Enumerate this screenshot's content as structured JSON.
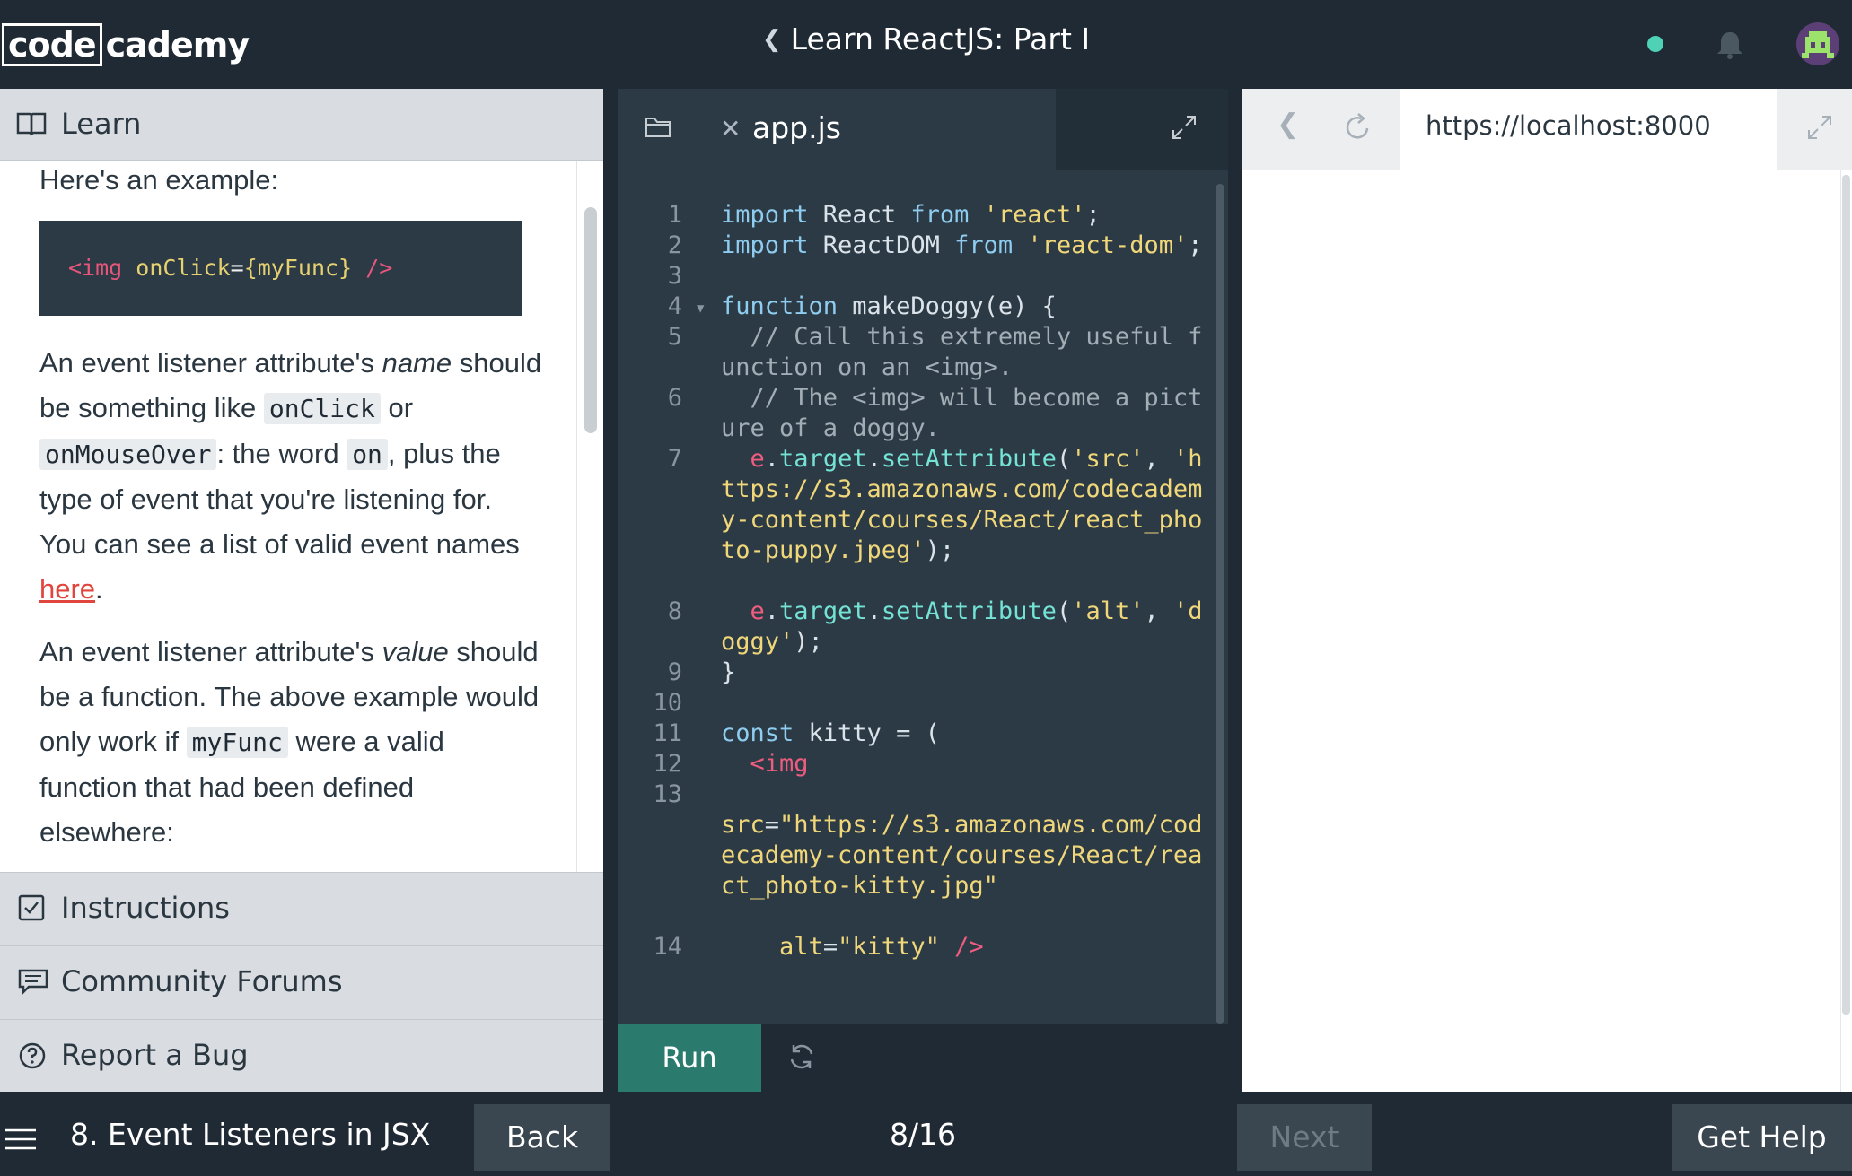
{
  "header": {
    "logo_part1": "code",
    "logo_part2": "cademy",
    "course_title": "Learn ReactJS: Part I",
    "status_color": "#4fd1b5"
  },
  "learn": {
    "tab_label": "Learn",
    "intro": "Here's an example:",
    "example_code": {
      "tag": "<img",
      "attr": "onClick",
      "value": "{myFunc}",
      "close": "/>"
    },
    "para1": {
      "t1": "An event listener attribute's ",
      "em1": "name",
      "t2": " should be something like ",
      "code1": "onClick",
      "t3": " or ",
      "code2": "onMouseOver",
      "t4": ": the word ",
      "code3": "on",
      "t5": ", plus the type of event that you're listening for. You can see a list of valid event names ",
      "link": "here",
      "t6": "."
    },
    "para2": {
      "t1": "An event listener attribute's ",
      "em1": "value",
      "t2": " should be a function. The above example would only work if ",
      "code1": "myFunc",
      "t3": " were a valid function that had been defined elsewhere:"
    }
  },
  "sidebar": {
    "items": [
      {
        "label": "Instructions",
        "icon": "checkbox-icon"
      },
      {
        "label": "Community Forums",
        "icon": "chat-icon"
      },
      {
        "label": "Report a Bug",
        "icon": "question-icon"
      }
    ]
  },
  "editor": {
    "file_name": "app.js",
    "run_label": "Run",
    "lines": [
      {
        "n": "1"
      },
      {
        "n": "2"
      },
      {
        "n": "3"
      },
      {
        "n": "4"
      },
      {
        "n": "5"
      },
      {
        "n": "6"
      },
      {
        "n": "7"
      },
      {
        "n": "8"
      },
      {
        "n": "9"
      },
      {
        "n": "10"
      },
      {
        "n": "11"
      },
      {
        "n": "12"
      },
      {
        "n": "13"
      },
      {
        "n": "14"
      }
    ],
    "code": {
      "l1": [
        "import",
        " React ",
        "from",
        " ",
        "'react'",
        ";"
      ],
      "l2": [
        "import",
        " ReactDOM ",
        "from",
        " ",
        "'react-dom'",
        ";"
      ],
      "l4": [
        "function",
        " makeDoggy(e) {"
      ],
      "l5": "  // Call this extremely useful function on an <img>.",
      "l6": "  // The <img> will become a picture of a doggy.",
      "l7": [
        "  e",
        ".",
        "target",
        ".",
        "setAttribute",
        "(",
        "'src'",
        ", ",
        "'https://s3.amazonaws.com/codecademy-content/courses/React/react_photo-puppy.jpeg'",
        ");"
      ],
      "l8": [
        "  e",
        ".",
        "target",
        ".",
        "setAttribute",
        "(",
        "'alt'",
        ", ",
        "'doggy'",
        ");"
      ],
      "l9": "}",
      "l11": [
        "const",
        " kitty = ("
      ],
      "l12": "  <img",
      "l13": [
        "src",
        "=",
        "\"https://s3.amazonaws.com/codecademy-content/courses/React/react_photo-kitty.jpg\""
      ],
      "l14": [
        "    alt",
        "=",
        "\"kitty\"",
        " />"
      ]
    }
  },
  "browser": {
    "url": "https://localhost:8000"
  },
  "footer": {
    "lesson": "8. Event Listeners in JSX",
    "back_label": "Back",
    "progress": "8/16",
    "next_label": "Next",
    "help_label": "Get Help"
  }
}
